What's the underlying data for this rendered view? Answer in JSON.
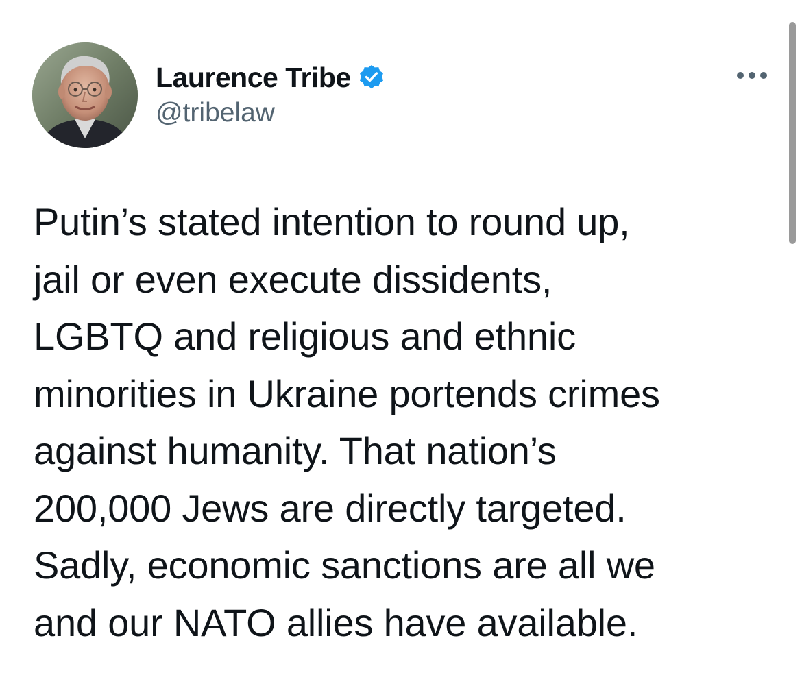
{
  "author": {
    "display_name": "Laurence Tribe",
    "handle": "@tribelaw",
    "verified": true
  },
  "tweet": {
    "text": "Putin’s stated intention to round up,\njail or even execute dissidents,\nLGBTQ and religious and ethnic\nminorities in Ukraine portends crimes\nagainst humanity. That nation’s\n200,000 Jews are directly targeted.\nSadly, economic sanctions are all we\nand our NATO allies have available."
  },
  "icons": {
    "verified": "verified-badge-icon",
    "more": "more-options-icon"
  },
  "colors": {
    "text_primary": "#0f1419",
    "text_secondary": "#536471",
    "verified_blue": "#1d9bf0",
    "background": "#ffffff"
  }
}
